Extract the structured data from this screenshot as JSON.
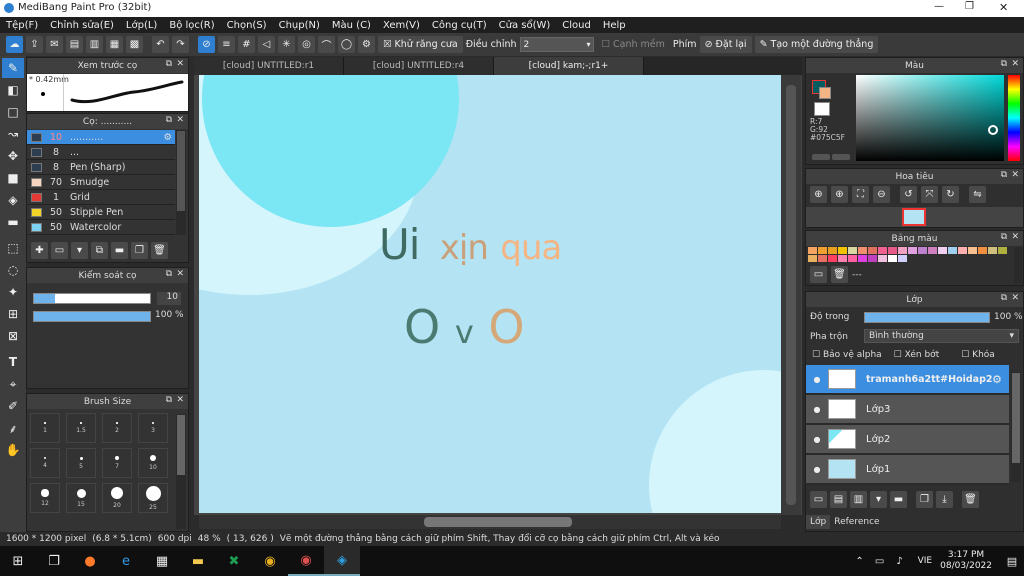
{
  "window": {
    "title": "MediBang Paint Pro (32bit)",
    "min": "—",
    "max": "❐",
    "close": "✕"
  },
  "menu": [
    "Tệp(F)",
    "Chỉnh sửa(E)",
    "Lớp(L)",
    "Bộ lọc(R)",
    "Chọn(S)",
    "Chụp(N)",
    "Màu (C)",
    "Xem(V)",
    "Công cụ(T)",
    "Cửa sổ(W)",
    "Cloud",
    "Help"
  ],
  "toolbar": {
    "antialias_label": "Khử răng cưa",
    "adjust_label": "Điều chỉnh",
    "adjust_value": "2",
    "edge_label": "Cạnh mềm",
    "keys_label": "Phím",
    "reset_label": "Đặt lại",
    "straight_label": "Tạo một đường thẳng"
  },
  "tabs": [
    "[cloud] UNTITLED:r1",
    "[cloud] UNTITLED:r4",
    "[cloud] kam;-;r1+"
  ],
  "brush_preview": {
    "title": "Xem trước cọ",
    "size": "0.42mm"
  },
  "brush_list": {
    "title": "Cọ: ...........",
    "items": [
      {
        "num": "10",
        "name": "...........",
        "color": "#2c3e50"
      },
      {
        "num": "8",
        "name": "...",
        "color": "#2c3e50"
      },
      {
        "num": "8",
        "name": "Pen (Sharp)",
        "color": "#2c3e50"
      },
      {
        "num": "70",
        "name": "Smudge",
        "color": "#f5d5c0"
      },
      {
        "num": "1",
        "name": "Grid",
        "color": "#e53935"
      },
      {
        "num": "50",
        "name": "Stipple Pen",
        "color": "#f2d32a"
      },
      {
        "num": "50",
        "name": "Watercolor",
        "color": "#7ed0f0"
      }
    ]
  },
  "brush_control": {
    "title": "Kiểm soát cọ",
    "size_value": "10",
    "opacity_value": "100 %",
    "size_fraction": 0.18,
    "opacity_fraction": 1.0
  },
  "brush_size": {
    "title": "Brush Size",
    "labels": [
      "1",
      "1.5",
      "2",
      "3",
      "4",
      "5",
      "7",
      "10",
      "12",
      "15",
      "20",
      "25"
    ]
  },
  "canvas_text": {
    "line1_a": "Ui",
    "line1_b": "xịn",
    "line1_c": "qua",
    "line2_a": "O",
    "line2_b": "v",
    "line2_c": "O"
  },
  "color_panel": {
    "title": "Màu",
    "r": "R:7",
    "g": "G:92",
    "b": "#075C5F"
  },
  "navigator": {
    "title": "Hoa tiêu"
  },
  "palette": {
    "title": "Bảng màu",
    "placeholder": "---",
    "colors": [
      "#f4a460",
      "#f0a030",
      "#e8a020",
      "#f2c300",
      "#d8d8a0",
      "#f09070",
      "#e07060",
      "#f06090",
      "#e85a8a",
      "#f0a0c0",
      "#e0a0e0",
      "#c080d0",
      "#d080c0",
      "#f0d0f0",
      "#a0d0f0",
      "#ffb0b0",
      "#f8c090",
      "#f09040",
      "#d0c080",
      "#b0b040",
      "#e8b060",
      "#e87060",
      "#ff4060",
      "#ff80b0",
      "#ff60a0",
      "#e040e0",
      "#c040c0",
      "#f0c0e0",
      "#ffffff",
      "#d0d0ff"
    ]
  },
  "layers": {
    "title": "Lớp",
    "opacity_label": "Độ trong",
    "opacity_value": "100 %",
    "opacity_fraction": 1.0,
    "blend_label": "Pha trộn",
    "blend_value": "Bình thường",
    "protect_alpha": "Bảo vệ alpha",
    "clip": "Xén bớt",
    "lock": "Khóa",
    "items": [
      {
        "name": "tramanh6a2tt#Hoidap247"
      },
      {
        "name": "Lớp3"
      },
      {
        "name": "Lớp2"
      },
      {
        "name": "Lớp1"
      }
    ],
    "bottom_tabs": [
      "Lớp",
      "Reference"
    ]
  },
  "status": {
    "dims": "1600 * 1200 pixel",
    "cm": "(6.8 * 5.1cm)",
    "dpi": "600 dpi",
    "zoom": "48 %",
    "coords": "( 13, 626 )",
    "hint": "Vẽ một đường thẳng bằng cách giữ phím Shift, Thay đổi cỡ cọ bằng cách giữ phím Ctrl, Alt và kéo"
  },
  "taskbar": {
    "lang": "VIE",
    "time": "3:17 PM",
    "date": "08/03/2022"
  },
  "colors": {
    "accent": "#3c8fe0",
    "canvas_bg": "#b4e4f4",
    "circle_main": "#7be6f4",
    "circle_light": "#d4f5fb",
    "text_dark": "#3f6a62",
    "text_tan": "#d4a878",
    "text_peach": "#f4b483"
  }
}
